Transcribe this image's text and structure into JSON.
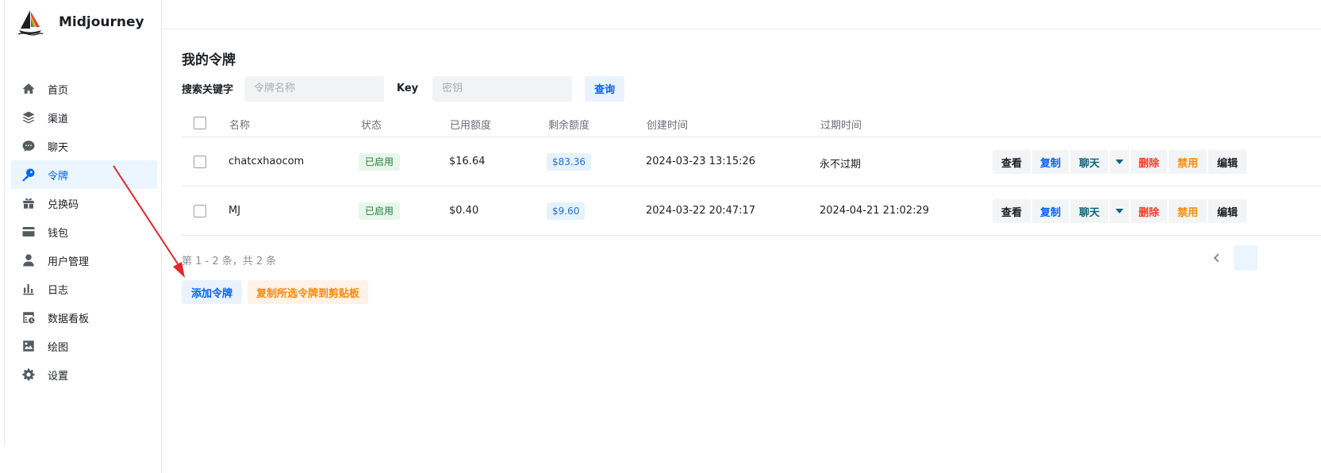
{
  "brand": {
    "name": "Midjourney",
    "logo_icon": "sailboat-logo-icon"
  },
  "sidebar": {
    "items": [
      {
        "label": "首页",
        "icon": "home-icon",
        "active": false
      },
      {
        "label": "渠道",
        "icon": "layers-icon",
        "active": false
      },
      {
        "label": "聊天",
        "icon": "chat-bubble-icon",
        "active": false
      },
      {
        "label": "令牌",
        "icon": "key-icon",
        "active": true
      },
      {
        "label": "兑换码",
        "icon": "gift-icon",
        "active": false
      },
      {
        "label": "钱包",
        "icon": "credit-card-icon",
        "active": false
      },
      {
        "label": "用户管理",
        "icon": "user-icon",
        "active": false
      },
      {
        "label": "日志",
        "icon": "bar-chart-icon",
        "active": false
      },
      {
        "label": "数据看板",
        "icon": "dashboard-icon",
        "active": false
      },
      {
        "label": "绘图",
        "icon": "image-icon",
        "active": false
      },
      {
        "label": "设置",
        "icon": "gear-icon",
        "active": false
      }
    ]
  },
  "page": {
    "title": "我的令牌",
    "search": {
      "keyword_label": "搜索关键字",
      "keyword_placeholder": "令牌名称",
      "key_label": "Key",
      "key_placeholder": "密钥",
      "query_button": "查询"
    },
    "table": {
      "columns": [
        "名称",
        "状态",
        "已用额度",
        "剩余额度",
        "创建时间",
        "过期时间"
      ],
      "rows": [
        {
          "name": "chatcxhaocom",
          "status": "已启用",
          "used": "$16.64",
          "remaining": "$83.36",
          "created": "2024-03-23 13:15:26",
          "expires": "永不过期"
        },
        {
          "name": "MJ",
          "status": "已启用",
          "used": "$0.40",
          "remaining": "$9.60",
          "created": "2024-03-22 20:47:17",
          "expires": "2024-04-21 21:02:29"
        }
      ],
      "actions": {
        "view": "查看",
        "copy": "复制",
        "chat": "聊天",
        "delete": "删除",
        "disable": "禁用",
        "edit": "编辑"
      }
    },
    "pager_text": "第 1 - 2 条，共 2 条",
    "add_button": "添加令牌",
    "copy_selected_button": "复制所选令牌到剪贴板"
  },
  "colors": {
    "accent": "#0064fa",
    "active_bg": "#eaf5ff",
    "danger": "#f93920",
    "warning": "#fc8800",
    "annotation_arrow": "#e8232a"
  }
}
